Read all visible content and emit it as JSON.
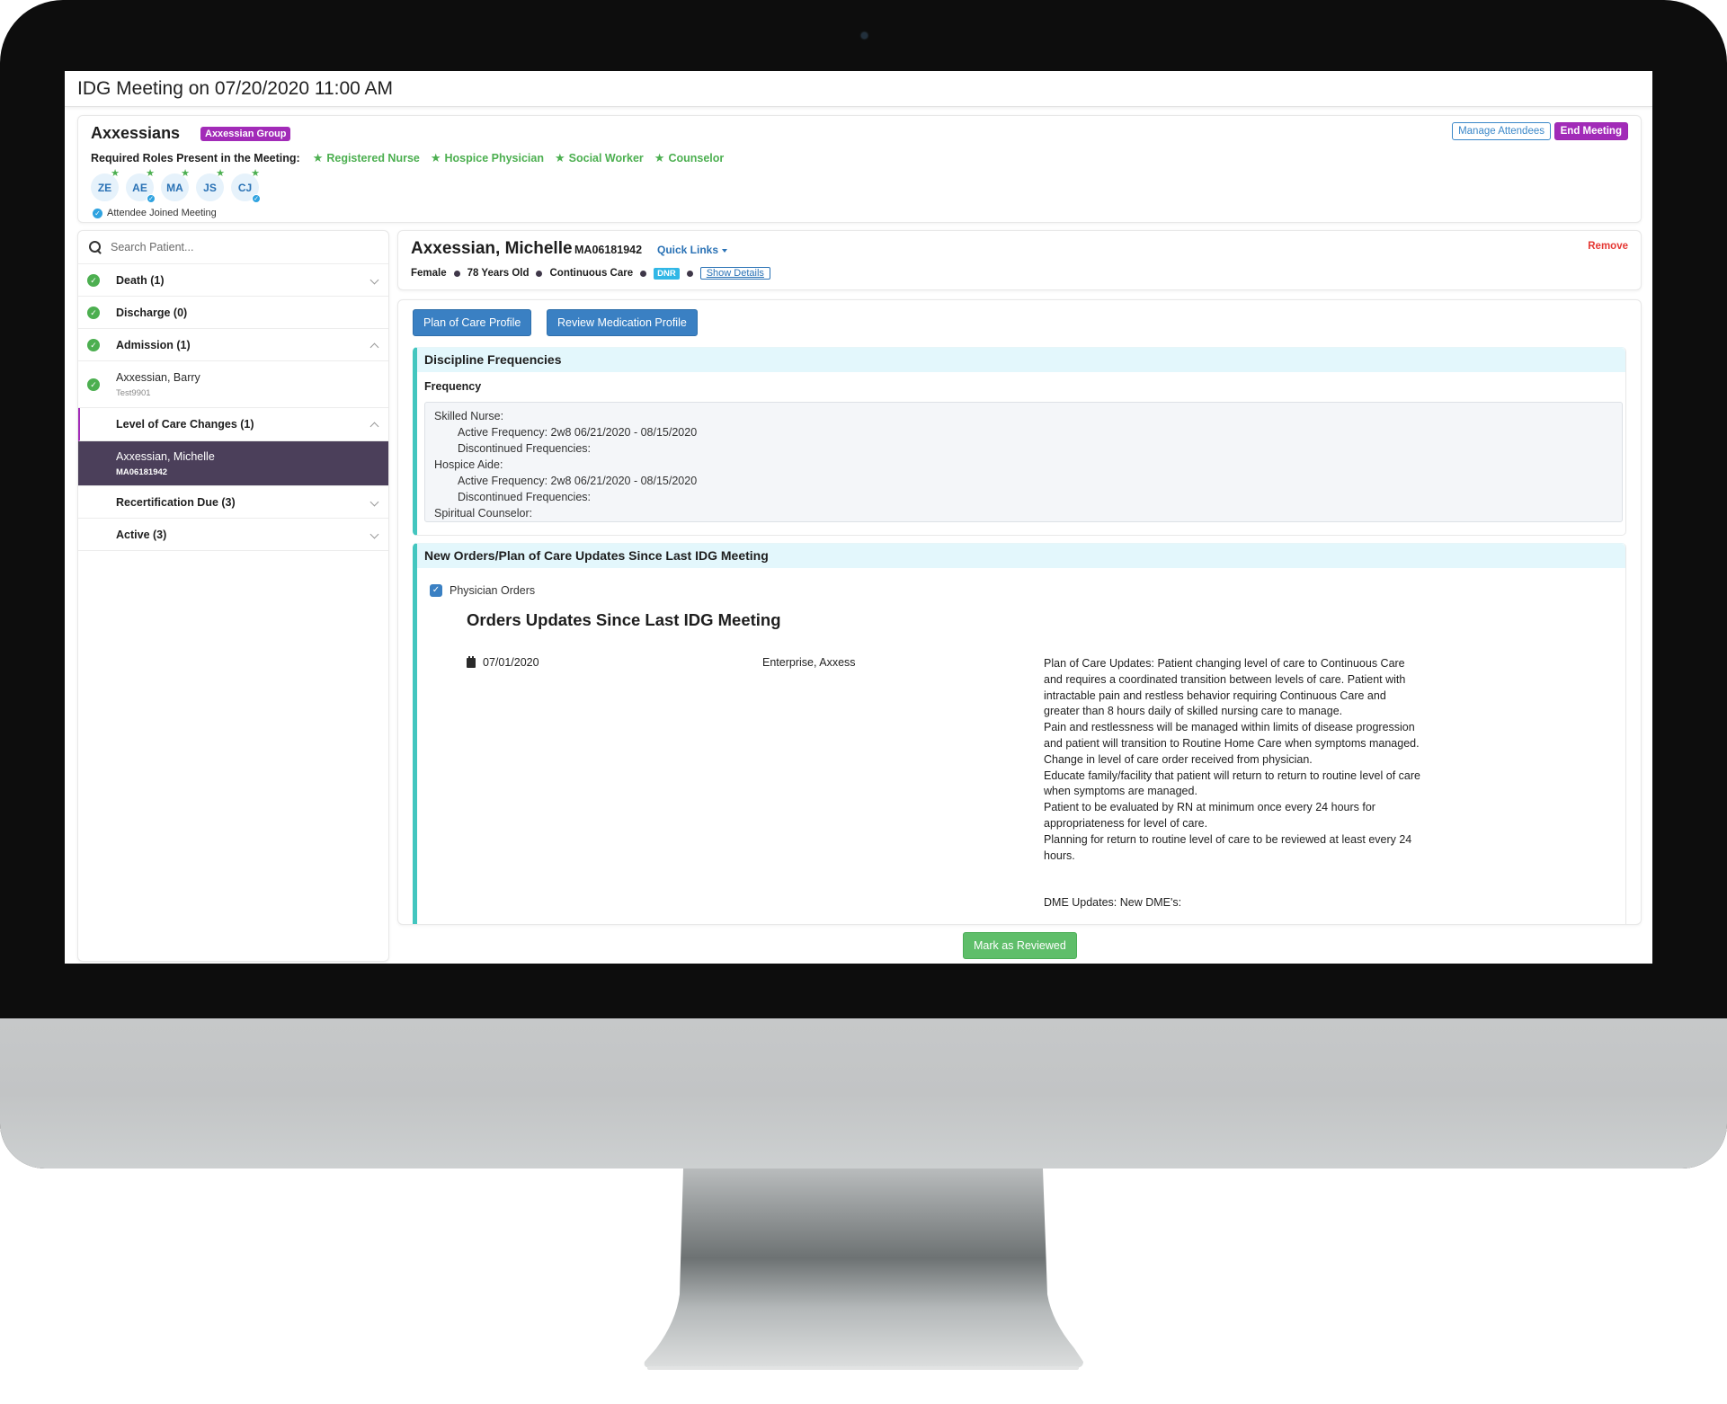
{
  "page": {
    "title": "IDG Meeting on 07/20/2020 11:00 AM"
  },
  "meeting": {
    "group_name": "Axxessians",
    "group_badge": "Axxessian Group",
    "roles_label": "Required Roles Present in the Meeting:",
    "roles": [
      "Registered Nurse",
      "Hospice Physician",
      "Social Worker",
      "Counselor"
    ],
    "attendees": [
      {
        "initials": "ZE",
        "required_role": true,
        "joined": false
      },
      {
        "initials": "AE",
        "required_role": true,
        "joined": true
      },
      {
        "initials": "MA",
        "required_role": true,
        "joined": false
      },
      {
        "initials": "JS",
        "required_role": true,
        "joined": false
      },
      {
        "initials": "CJ",
        "required_role": true,
        "joined": true
      }
    ],
    "joined_legend": "Attendee Joined Meeting",
    "manage_attendees_label": "Manage Attendees",
    "end_meeting_label": "End Meeting"
  },
  "sidebar": {
    "search_placeholder": "Search Patient...",
    "groups": [
      {
        "label": "Death (1)",
        "complete": true,
        "expanded": false
      },
      {
        "label": "Discharge (0)",
        "complete": true,
        "expanded": false
      },
      {
        "label": "Admission (1)",
        "complete": true,
        "expanded": true,
        "patients": [
          {
            "name": "Axxessian, Barry",
            "id": "Test9901",
            "complete": true
          }
        ]
      },
      {
        "label": "Level of Care Changes (1)",
        "complete": false,
        "expanded": true,
        "active": true,
        "patients": [
          {
            "name": "Axxessian, Michelle",
            "id": "MA06181942",
            "selected": true
          }
        ]
      },
      {
        "label": "Recertification Due (3)",
        "complete": false,
        "expanded": false
      },
      {
        "label": "Active (3)",
        "complete": false,
        "expanded": false
      }
    ]
  },
  "patient": {
    "name": "Axxessian, Michelle",
    "mrn": "MA06181942",
    "quick_links_label": "Quick Links",
    "gender": "Female",
    "age": "78 Years Old",
    "level_of_care": "Continuous Care",
    "dnr_badge": "DNR",
    "show_details_label": "Show Details",
    "remove_label": "Remove"
  },
  "main": {
    "plan_of_care_btn": "Plan of Care Profile",
    "review_med_btn": "Review Medication Profile",
    "discipline": {
      "title": "Discipline Frequencies",
      "frequency_label": "Frequency",
      "lines": [
        {
          "text": "Skilled Nurse:",
          "indent": false
        },
        {
          "text": "Active Frequency: 2w8 06/21/2020 - 08/15/2020",
          "indent": true
        },
        {
          "text": "Discontinued Frequencies:",
          "indent": true
        },
        {
          "text": "Hospice Aide:",
          "indent": false
        },
        {
          "text": "Active Frequency: 2w8 06/21/2020 - 08/15/2020",
          "indent": true
        },
        {
          "text": "Discontinued Frequencies:",
          "indent": true
        },
        {
          "text": "Spiritual Counselor:",
          "indent": false
        }
      ]
    },
    "orders": {
      "title": "New Orders/Plan of Care Updates Since Last IDG Meeting",
      "physician_orders_label": "Physician Orders",
      "physician_orders_checked": true,
      "heading": "Orders Updates Since Last IDG Meeting",
      "entry": {
        "date": "07/01/2020",
        "author": "Enterprise, Axxess",
        "notes": [
          "Plan of Care Updates: Patient changing level of care to Continuous Care and requires a coordinated transition between levels of care. Patient with intractable pain and restless behavior requiring Continuous Care and greater than 8 hours daily of skilled nursing care to manage.",
          "Pain and restlessness will be managed within limits of disease progression and patient will transition to Routine Home Care when symptoms managed.",
          "Change in level of care order received from physician.",
          "Educate family/facility that patient will return to return to routine level of care when symptoms are managed.",
          "Patient to be evaluated by RN at minimum once every 24 hours for appropriateness for level of care.",
          "Planning for return to routine level of care to be reviewed at least every 24 hours."
        ],
        "dme_updates": "DME Updates: New DME's:"
      }
    },
    "mark_reviewed_label": "Mark as Reviewed"
  },
  "colors": {
    "accent_purple": "#a22bb8",
    "primary_blue": "#3a80c3",
    "success_green": "#4caf50",
    "danger_red": "#e53935",
    "section_teal": "#43c6bf",
    "selected_row": "#4b3f5a"
  }
}
